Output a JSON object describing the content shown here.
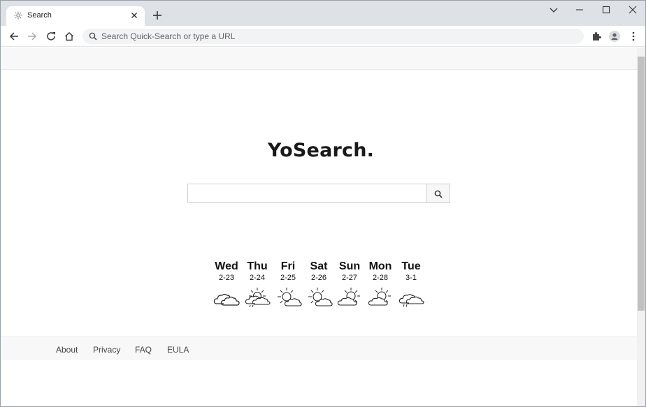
{
  "browser": {
    "tab": {
      "title": "Search",
      "favicon": "sun-icon"
    },
    "address_bar": {
      "placeholder": "Search Quick-Search or type a URL",
      "value": ""
    },
    "icons": [
      "back-icon",
      "forward-icon",
      "reload-icon",
      "home-icon",
      "extensions-icon",
      "profile-icon",
      "menu-icon",
      "minimize-icon",
      "maximize-icon",
      "close-icon",
      "chevron-down-icon",
      "new-tab-icon"
    ]
  },
  "page": {
    "logo": "YoSearch.",
    "search": {
      "placeholder": "",
      "value": ""
    },
    "weather": [
      {
        "day": "Wed",
        "date": "2-23",
        "icon": "cloudy-icon"
      },
      {
        "day": "Thu",
        "date": "2-24",
        "icon": "sun-cloud-rain-icon"
      },
      {
        "day": "Fri",
        "date": "2-25",
        "icon": "partly-sunny-icon"
      },
      {
        "day": "Sat",
        "date": "2-26",
        "icon": "partly-sunny-icon"
      },
      {
        "day": "Sun",
        "date": "2-27",
        "icon": "partly-sunny-icon"
      },
      {
        "day": "Mon",
        "date": "2-28",
        "icon": "partly-sunny-icon"
      },
      {
        "day": "Tue",
        "date": "3-1",
        "icon": "rain-cloud-icon"
      }
    ],
    "footer": {
      "links": [
        "About",
        "Privacy",
        "FAQ",
        "EULA"
      ]
    }
  },
  "colors": {
    "tabstrip": "#dee1e6",
    "omnibox": "#f1f3f4",
    "text": "#202124"
  }
}
